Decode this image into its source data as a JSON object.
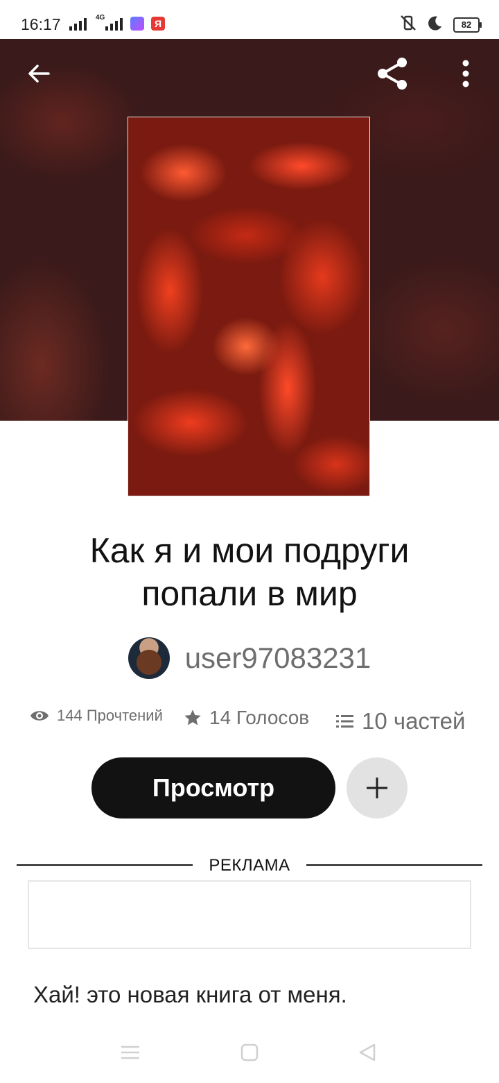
{
  "status_bar": {
    "time": "16:17",
    "network": "4G",
    "battery": "82",
    "apps": {
      "yandex_label": "Я"
    }
  },
  "toolbar": {
    "back_icon": "arrow-left-icon",
    "share_icon": "share-icon",
    "more_icon": "more-vertical-icon"
  },
  "book": {
    "title": "Как я и мои подруги попали в мир",
    "author": "user97083231",
    "stats": {
      "reads": "144 Прочтений",
      "votes": "14 Голосов",
      "parts": "10 частей"
    },
    "read_button": "Просмотр",
    "description": "Хай! это новая книга от меня."
  },
  "ad": {
    "label": "РЕКЛАМА"
  },
  "colors": {
    "accent_dark": "#121212",
    "hero_bg": "#3a1a1a",
    "cover_red": "#ff4a2a",
    "muted_text": "#6e6e6e"
  }
}
